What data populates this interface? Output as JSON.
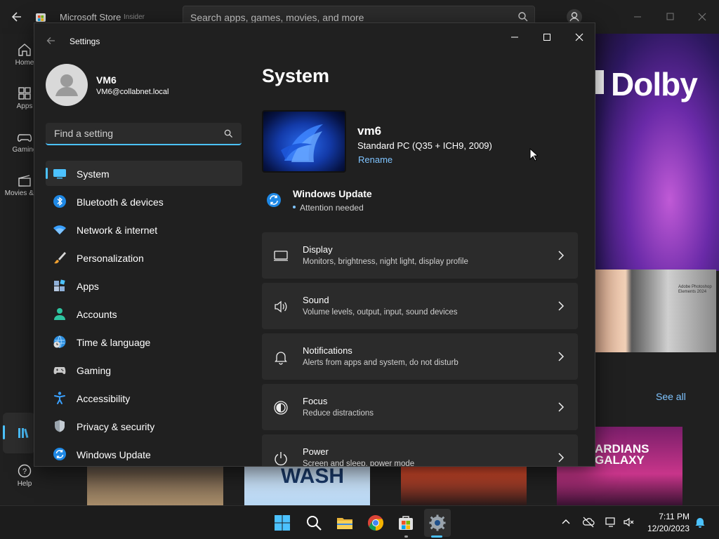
{
  "store": {
    "title": "Microsoft Store",
    "badge": "Insider",
    "search_placeholder": "Search apps, games, movies, and more",
    "nav": [
      {
        "label": "Home",
        "icon": "home-icon"
      },
      {
        "label": "Apps",
        "icon": "apps-icon"
      },
      {
        "label": "Gaming",
        "icon": "gaming-icon"
      },
      {
        "label": "Movies & TV",
        "icon": "movies-icon"
      },
      {
        "label": "Help",
        "icon": "help-icon"
      }
    ],
    "hero_brand": "Dolby",
    "tile_label": "Adobe Photoshop Elements 2024",
    "see_all": "See all",
    "cards": [
      {
        "text": ""
      },
      {
        "text": "WASH"
      },
      {
        "text": ""
      },
      {
        "text": "ARDIANS GALAXY"
      }
    ]
  },
  "settings": {
    "window_title": "Settings",
    "user": {
      "name": "VM6",
      "email": "VM6@collabnet.local"
    },
    "search_placeholder": "Find a setting",
    "menu": [
      {
        "label": "System",
        "icon": "system-icon",
        "selected": true
      },
      {
        "label": "Bluetooth & devices",
        "icon": "bluetooth-icon"
      },
      {
        "label": "Network & internet",
        "icon": "wifi-icon"
      },
      {
        "label": "Personalization",
        "icon": "brush-icon"
      },
      {
        "label": "Apps",
        "icon": "apps-icon"
      },
      {
        "label": "Accounts",
        "icon": "accounts-icon"
      },
      {
        "label": "Time & language",
        "icon": "globe-clock-icon"
      },
      {
        "label": "Gaming",
        "icon": "gamepad-icon"
      },
      {
        "label": "Accessibility",
        "icon": "accessibility-icon"
      },
      {
        "label": "Privacy & security",
        "icon": "shield-icon"
      },
      {
        "label": "Windows Update",
        "icon": "update-icon"
      }
    ],
    "page_title": "System",
    "device": {
      "name": "vm6",
      "model": "Standard PC (Q35 + ICH9, 2009)",
      "rename_label": "Rename"
    },
    "windows_update": {
      "title": "Windows Update",
      "status": "Attention needed"
    },
    "cards": [
      {
        "title": "Display",
        "subtitle": "Monitors, brightness, night light, display profile",
        "icon": "display-icon"
      },
      {
        "title": "Sound",
        "subtitle": "Volume levels, output, input, sound devices",
        "icon": "speaker-icon"
      },
      {
        "title": "Notifications",
        "subtitle": "Alerts from apps and system, do not disturb",
        "icon": "bell-icon"
      },
      {
        "title": "Focus",
        "subtitle": "Reduce distractions",
        "icon": "focus-icon"
      },
      {
        "title": "Power",
        "subtitle": "Screen and sleep, power mode",
        "icon": "power-icon"
      }
    ]
  },
  "taskbar": {
    "time": "7:11 PM",
    "date": "12/20/2023",
    "accent": "#4cc2ff"
  }
}
